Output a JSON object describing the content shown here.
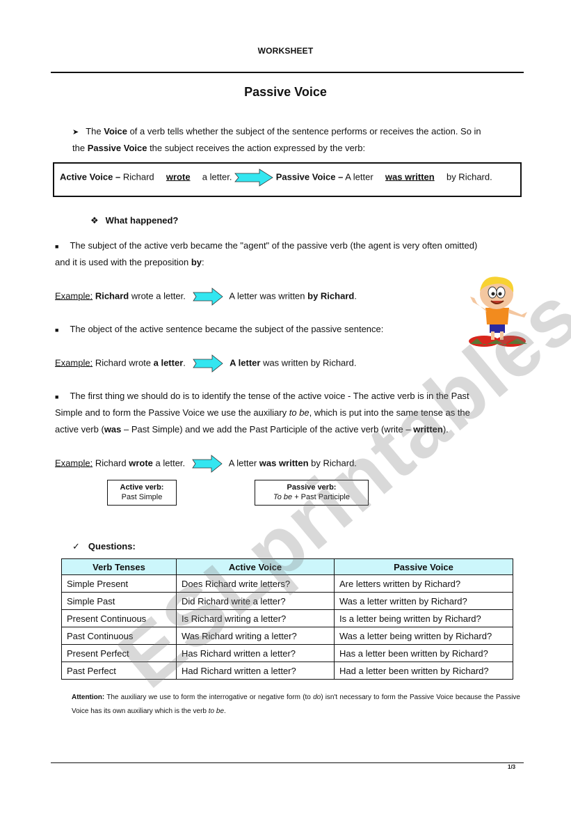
{
  "header": {
    "title": "WORKSHEET"
  },
  "page_title": "Passive Voice",
  "intro": {
    "icon": "arrow-bullet-icon",
    "line1": {
      "a": "The ",
      "b": "Voice",
      "c": " of a verb tells whether the subject of the sentence performs or receives the action. So in"
    },
    "line2": {
      "a": "the ",
      "b": "Passive Voice",
      "c": " the subject receives the action expressed by the verb:"
    }
  },
  "voice_box": {
    "active_label": "Active Voice –",
    "active_subject": "Richard",
    "active_verb": "wrote",
    "active_object": "a letter.",
    "passive_label": "Passive Voice –",
    "passive_subject": "A letter",
    "passive_verb": "was written",
    "passive_agent": "by Richard.",
    "arrow_color": "#33e6f0"
  },
  "what_happened": {
    "icon": "diamond-bullet-icon",
    "label": "What happened?"
  },
  "point1": {
    "line1": "The subject of the active verb became the \"agent\" of the passive verb (the agent is very often omitted)",
    "line2a": "and it is used with the preposition ",
    "line2b": "by",
    "line2c": ":"
  },
  "example1": {
    "label": "Example:",
    "a": " ",
    "b": "Richard",
    "c": " wrote a letter.",
    "d": "A letter was written ",
    "e": "by Richard",
    "f": "."
  },
  "point2": {
    "text": "The object of the active sentence became the subject of the passive sentence:"
  },
  "example2": {
    "label": "Example:",
    "a": " Richard wrote ",
    "b": "a letter",
    "c": ".",
    "d": "A letter",
    "e": " was written by Richard."
  },
  "point3": {
    "line1": "The first thing we should do is to identify the tense of the active voice - The active verb is in the Past",
    "line2a": "Simple and to form the Passive Voice we use the auxiliary ",
    "line2b": "to be",
    "line2c": ", which is put into the same tense as the",
    "line3a": "active verb (",
    "line3b": "was",
    "line3c": " – Past Simple) and we add the Past Participle of the active verb (write – ",
    "line3d": "written",
    "line3e": ")."
  },
  "example3": {
    "label": "Example:",
    "a": " Richard ",
    "b": "wrote",
    "c": " a letter.",
    "d": "A letter ",
    "e": "was written",
    "f": " by Richard."
  },
  "active_verb_box": {
    "title": "Active verb:",
    "text": "Past Simple"
  },
  "passive_verb_box": {
    "title": "Passive verb:",
    "text_italic": "To be",
    "text": " + Past Participle"
  },
  "questions": {
    "icon": "checkmark-icon",
    "label": "Questions:",
    "header_color": "#ccf6fb",
    "columns": [
      "Verb Tenses",
      "Active Voice",
      "Passive Voice"
    ],
    "rows": [
      [
        "Simple Present",
        "Does Richard write letters?",
        "Are letters written by Richard?"
      ],
      [
        "Simple Past",
        "Did Richard write a letter?",
        "Was a letter written by Richard?"
      ],
      [
        "Present Continuous",
        "Is Richard writing a letter?",
        "Is a letter being written by Richard?"
      ],
      [
        "Past Continuous",
        "Was Richard writing a letter?",
        "Was a letter being written by Richard?"
      ],
      [
        "Present Perfect",
        "Has Richard written a letter?",
        "Has a letter been written by Richard?"
      ],
      [
        "Past Perfect",
        "Had Richard written a letter?",
        "Had a letter been written by Richard?"
      ]
    ]
  },
  "attention": {
    "label": "Attention:",
    "a": " The auxiliary we use to form the interrogative or negative form (to ",
    "b": "do",
    "c": ") isn't necessary to form the Passive Voice because the Passive Voice has its own auxiliary which is the verb ",
    "d": "to be",
    "e": "."
  },
  "watermark": "ESLprintables.com",
  "footer": {
    "page": "1/3"
  }
}
